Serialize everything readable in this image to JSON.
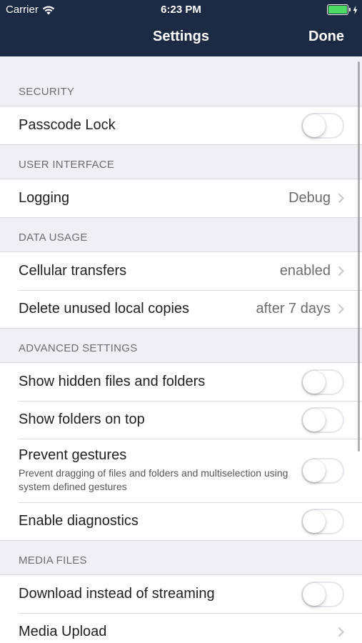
{
  "status_bar": {
    "carrier": "Carrier",
    "time": "6:23 PM",
    "battery_color": "#4cd964"
  },
  "nav": {
    "title": "Settings",
    "done_label": "Done",
    "background": "#1c2a44"
  },
  "sections": {
    "security": {
      "header": "SECURITY",
      "passcode_lock": {
        "label": "Passcode Lock",
        "on": false
      }
    },
    "user_interface": {
      "header": "USER INTERFACE",
      "logging": {
        "label": "Logging",
        "value": "Debug",
        "icon": "chevron-right-icon"
      }
    },
    "data_usage": {
      "header": "DATA USAGE",
      "cellular_transfers": {
        "label": "Cellular transfers",
        "value": "enabled",
        "icon": "chevron-right-icon"
      },
      "delete_unused": {
        "label": "Delete unused local copies",
        "value": "after 7 days",
        "icon": "chevron-right-icon"
      }
    },
    "advanced": {
      "header": "ADVANCED SETTINGS",
      "show_hidden": {
        "label": "Show hidden files and folders",
        "on": false
      },
      "folders_on_top": {
        "label": "Show folders on top",
        "on": false
      },
      "prevent_gestures": {
        "label": "Prevent gestures",
        "subtitle": "Prevent dragging of files and folders and multiselection using system defined gestures",
        "on": false
      },
      "enable_diagnostics": {
        "label": "Enable diagnostics",
        "on": false
      }
    },
    "media_files": {
      "header": "MEDIA FILES",
      "download_instead": {
        "label": "Download instead of streaming",
        "on": false
      },
      "media_upload": {
        "label": "Media Upload",
        "icon": "chevron-right-icon"
      }
    }
  }
}
